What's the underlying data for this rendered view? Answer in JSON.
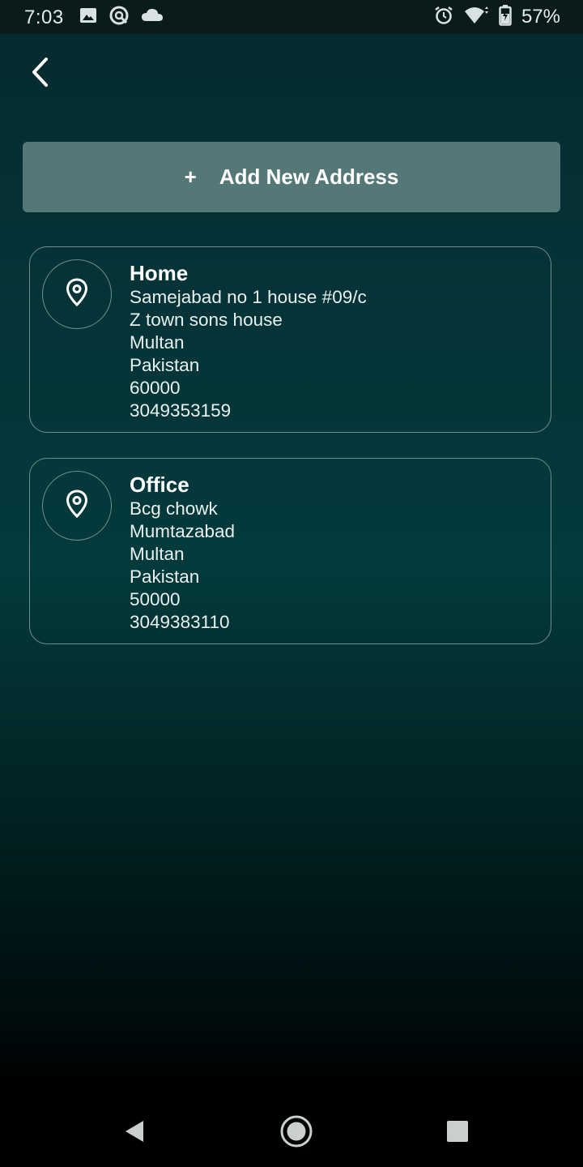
{
  "status_bar": {
    "time": "7:03",
    "battery": "57%",
    "icons_left": [
      "image-icon",
      "sync-icon",
      "cloud-icon"
    ],
    "icons_right": [
      "alarm-icon",
      "wifi-icon",
      "battery-charging-icon"
    ]
  },
  "header": {
    "back_icon": "chevron-left-icon"
  },
  "add_button": {
    "plus": "+",
    "label": "Add New Address",
    "background": "#537877"
  },
  "addresses": [
    {
      "title": "Home",
      "lines": [
        "Samejabad no 1 house #09/c",
        "Z town sons house",
        "Multan",
        "Pakistan",
        "60000",
        "3049353159"
      ],
      "icon": "location-pin-icon"
    },
    {
      "title": "Office",
      "lines": [
        "Bcg chowk",
        "Mumtazabad",
        "Multan",
        "Pakistan",
        "50000",
        "3049383110"
      ],
      "icon": "location-pin-icon"
    }
  ],
  "nav": {
    "icons": [
      "nav-back-icon",
      "nav-home-icon",
      "nav-recents-icon"
    ]
  }
}
